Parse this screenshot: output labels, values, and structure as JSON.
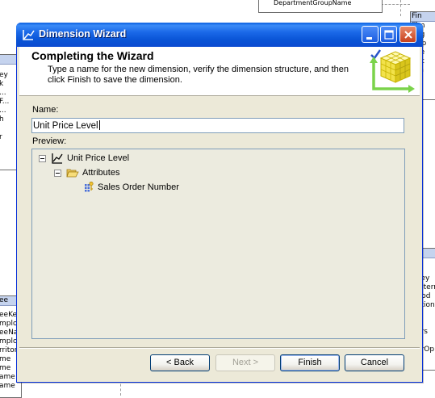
{
  "background": {
    "top_table_label": "DepartmentGroupName",
    "right_top_table": {
      "header": "Fin",
      "rows": [
        "Tim",
        "Org",
        "Dep",
        "Sce",
        "Acc",
        "Am"
      ]
    },
    "left_top_table": {
      "rows": [
        "ey",
        "k",
        "...",
        "F...",
        "...",
        "h",
        "",
        "r"
      ]
    },
    "left_bottom_table": {
      "header": "ee",
      "rows": [
        "eeKey",
        "mploy",
        "eeNat",
        "mploy",
        "rritory",
        "me",
        "me",
        "ame",
        "ame"
      ]
    },
    "right_bottom_table": {
      "rows": [
        "Key",
        "Altern",
        "Cod",
        "otion",
        "",
        "",
        "ers",
        "",
        "erOp"
      ]
    }
  },
  "window": {
    "title": "Dimension Wizard",
    "title_icon": "dimension-icon",
    "controls": [
      "minimize-icon",
      "maximize-icon",
      "close-icon"
    ]
  },
  "header": {
    "heading": "Completing the Wizard",
    "description": "Type a name for the new dimension, verify the dimension structure, and then click Finish to save the dimension.",
    "graphic": "cube-checkmark-graphic"
  },
  "form": {
    "name_label": "Name:",
    "name_value": "Unit Price Level",
    "preview_label": "Preview:"
  },
  "tree": {
    "root": {
      "label": "Unit Price Level",
      "icon": "dimension-icon",
      "expanded": true
    },
    "attributes": {
      "label": "Attributes",
      "icon": "folder-open-icon",
      "expanded": true
    },
    "items": [
      {
        "label": "Sales Order Number",
        "icon": "key-attribute-icon"
      }
    ]
  },
  "buttons": {
    "back": "< Back",
    "next": "Next >",
    "finish": "Finish",
    "cancel": "Cancel"
  },
  "colors": {
    "titlebar": "#0a55d6",
    "dialog_face": "#ece9d8",
    "preview_bg": "#ecebdf",
    "input_border": "#7f9db9"
  }
}
